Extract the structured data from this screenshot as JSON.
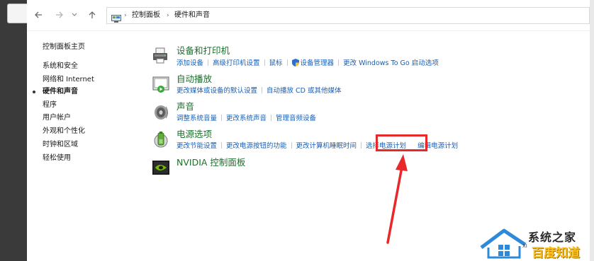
{
  "navbar": {
    "back_icon": "arrow-left-icon",
    "forward_icon": "arrow-right-icon",
    "dropdown_icon": "chevron-down-icon",
    "up_icon": "arrow-up-icon",
    "address": {
      "icon": "control-panel-icon",
      "crumbs": [
        "控制面板",
        "硬件和声音"
      ]
    }
  },
  "sidebar": {
    "home": "控制面板主页",
    "items": [
      {
        "label": "系统和安全",
        "active": false
      },
      {
        "label": "网络和 Internet",
        "active": false
      },
      {
        "label": "硬件和声音",
        "active": true
      },
      {
        "label": "程序",
        "active": false
      },
      {
        "label": "用户帐户",
        "active": false
      },
      {
        "label": "外观和个性化",
        "active": false
      },
      {
        "label": "时钟和区域",
        "active": false
      },
      {
        "label": "轻松使用",
        "active": false
      }
    ]
  },
  "categories": [
    {
      "title": "设备和打印机",
      "icon": "printer-icon",
      "links": [
        "添加设备",
        "高级打印机设置",
        "鼠标",
        "设备管理器",
        "更改 Windows To Go 启动选项"
      ]
    },
    {
      "title": "自动播放",
      "icon": "autoplay-icon",
      "links": [
        "更改媒体或设备的默认设置",
        "自动播放 CD 或其他媒体"
      ]
    },
    {
      "title": "声音",
      "icon": "speaker-icon",
      "links": [
        "调整系统音量",
        "更改系统声音",
        "管理音频设备"
      ]
    },
    {
      "title": "电源选项",
      "icon": "battery-icon",
      "links": [
        "更改节能设置",
        "更改电源按钮的功能",
        "更改计算机睡眠时间",
        "选择电源计划",
        "编辑电源计划"
      ]
    },
    {
      "title": "NVIDIA 控制面板",
      "icon": "nvidia-icon",
      "links": []
    }
  ],
  "annotation": {
    "highlight_color": "#e8292c",
    "highlighted_link": "选择电源计划"
  },
  "watermark": {
    "line1": "系统之家",
    "line2": "百度知道",
    "small": "XI"
  },
  "colors": {
    "link": "#1a5fb4",
    "category_title": "#1e6e2e",
    "annotation": "#e8292c"
  }
}
